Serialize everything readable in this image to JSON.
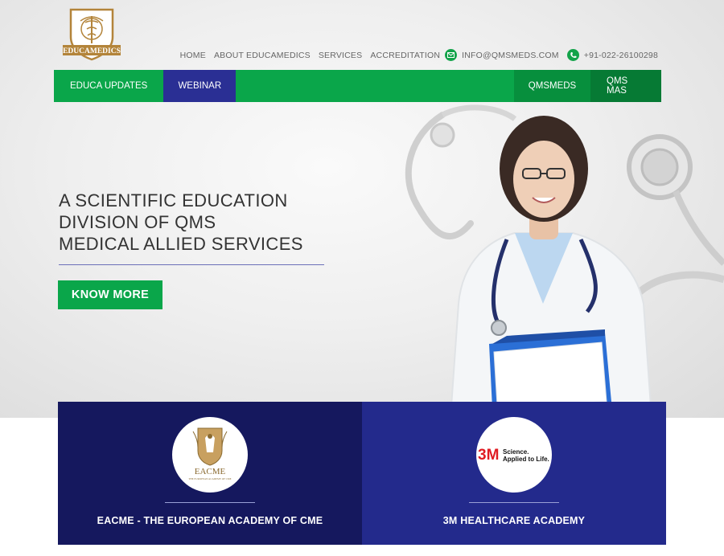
{
  "brand": {
    "name": "EDUCAMEDICS",
    "colors": {
      "green": "#0aa64a",
      "navy": "#2a2f94",
      "gold": "#b3843a"
    }
  },
  "topnav": {
    "links": [
      "HOME",
      "ABOUT EDUCAMEDICS",
      "SERVICES",
      "ACCREDITATION"
    ],
    "email": "INFO@QMSMEDS.COM",
    "phone": "+91-022-26100298"
  },
  "mainnav": {
    "left": [
      "EDUCA UPDATES",
      "WEBINAR"
    ],
    "right": [
      "QMSMEDS",
      "QMS MAS"
    ]
  },
  "hero": {
    "headline": [
      "A SCIENTIFIC EDUCATION",
      "DIVISION OF QMS",
      "MEDICAL ALLIED SERVICES"
    ],
    "cta": "KNOW MORE"
  },
  "academies": [
    {
      "title": "EACME - THE EUROPEAN ACADEMY OF CME",
      "logo_name": "EACME",
      "logo_sub": "THE EUROPEAN ACADEMY OF CME"
    },
    {
      "title": "3M HEALTHCARE ACADEMY",
      "logo_name": "3M",
      "logo_tag_1": "Science.",
      "logo_tag_2": "Applied to Life."
    }
  ]
}
